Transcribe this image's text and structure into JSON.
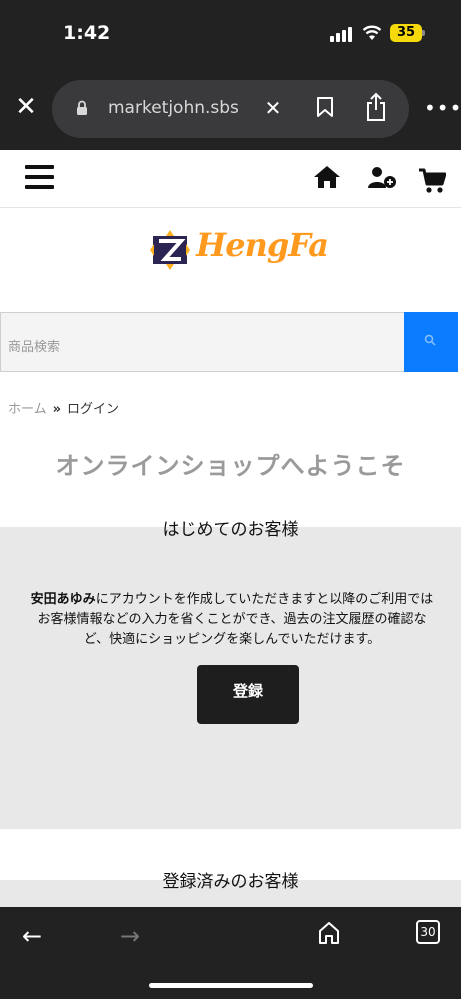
{
  "status_bar": {
    "time": "1:42",
    "battery": "35",
    "battery_color": "#f5d90a"
  },
  "browser": {
    "url": "marketjohn.sbs",
    "icons": [
      "close-icon",
      "lock-icon",
      "clear-icon",
      "bookmark-icon",
      "share-icon",
      "more-icon"
    ]
  },
  "header": {
    "icons": [
      "hamburger-menu-icon",
      "home-icon",
      "user-add-icon",
      "cart-icon"
    ]
  },
  "logo": {
    "text": "HengFa"
  },
  "search": {
    "placeholder": "商品検索",
    "button_color": "#0a7cff"
  },
  "breadcrumb": {
    "home": "ホーム",
    "separator": "»",
    "current": "ログイン"
  },
  "page_title": "オンラインショップへようこそ",
  "new_customer": {
    "heading": "はじめてのお客様",
    "shop_name": "安田あゆみ",
    "description": "にアカウントを作成していただきますと以降のご利用ではお客様情報などの入力を省くことができ、過去の注文履歴の確認など、快適にショッピングを楽しんでいただけます。",
    "register_button": "登録"
  },
  "existing_customer": {
    "heading": "登録済みのお客様"
  },
  "toolbar": {
    "back": "←",
    "forward": "→",
    "tab_count": "30"
  }
}
